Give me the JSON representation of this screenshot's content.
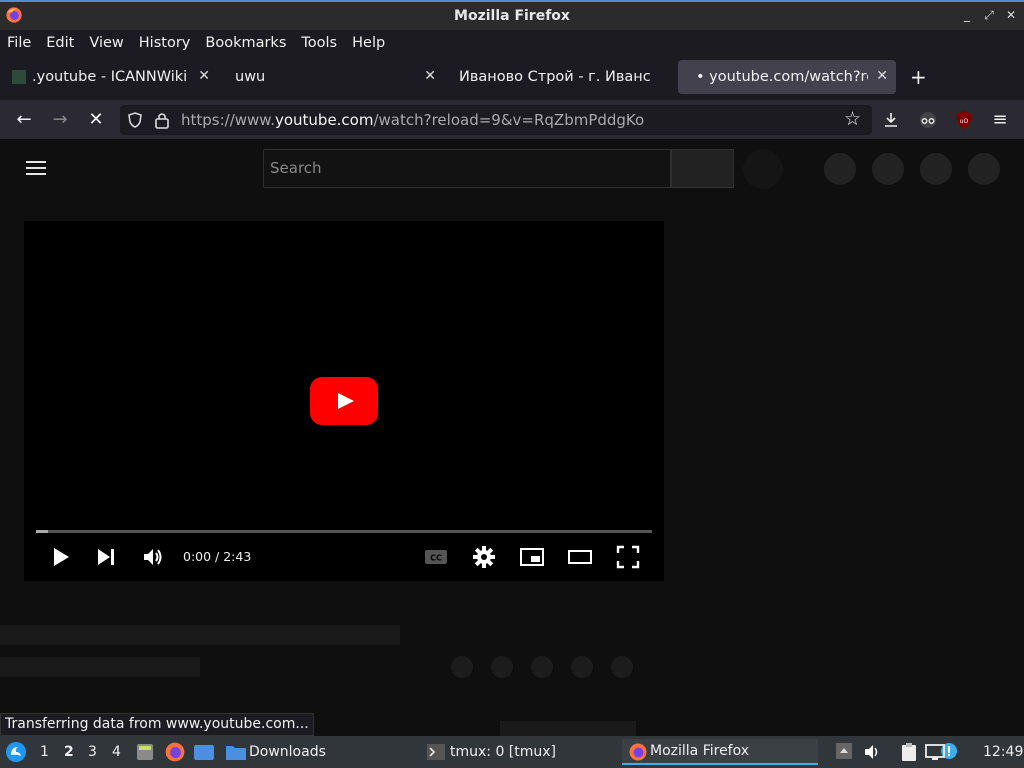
{
  "window": {
    "title": "Mozilla Firefox",
    "controls": [
      "_",
      "⤢",
      "✕"
    ]
  },
  "menubar": {
    "items": [
      "File",
      "Edit",
      "View",
      "History",
      "Bookmarks",
      "Tools",
      "Help"
    ]
  },
  "tabs": [
    {
      "label": ".youtube - ICANNWiki",
      "active": false
    },
    {
      "label": "uwu",
      "active": false
    },
    {
      "label": "Иваново Строй - г. Иванс",
      "active": false
    },
    {
      "label": "• youtube.com/watch?re",
      "active": true
    }
  ],
  "newtab_label": "+",
  "urlbar": {
    "prefix": "https://www.",
    "host": "youtube.com",
    "path": "/watch?reload=9&v=RqZbmPddgKo"
  },
  "youtube": {
    "search_placeholder": "Search",
    "time": "0:00 / 2:43",
    "progress": 0.02,
    "brand_red": "#ff0000"
  },
  "status_text": "Transferring data from www.youtube.com...",
  "taskbar": {
    "workspaces": [
      "1",
      "2",
      "3",
      "4"
    ],
    "active_workspace": "2",
    "downloads_label": "Downloads",
    "tmux_label": "tmux: 0 [tmux]",
    "firefox_label": "Mozilla Firefox",
    "clock": "12:49"
  },
  "icons": {
    "back": "back-arrow-icon",
    "forward": "forward-arrow-icon",
    "stop": "stop-icon",
    "shield": "tracking-shield-icon",
    "lock": "lock-icon",
    "star": "bookmark-star-icon",
    "download": "download-icon",
    "menu": "hamburger-menu-icon"
  }
}
